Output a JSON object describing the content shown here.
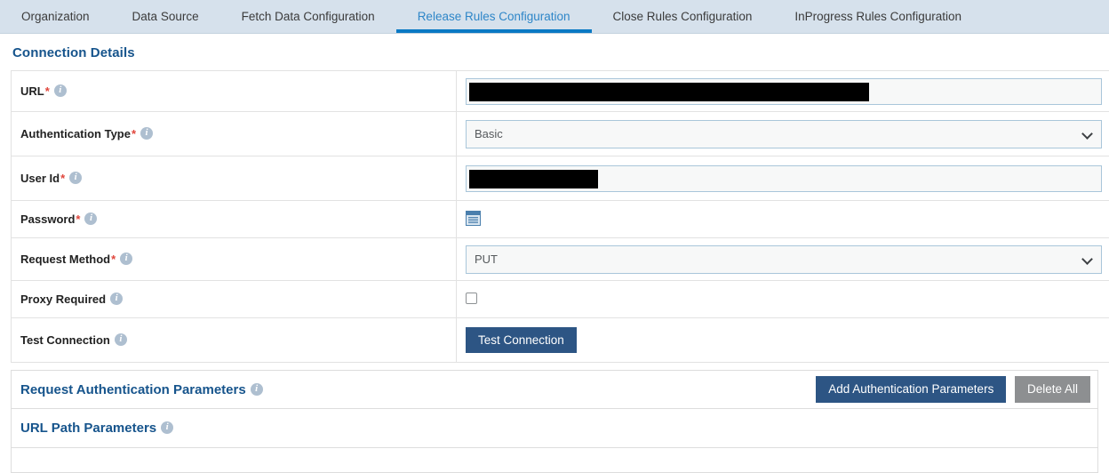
{
  "tabs": [
    {
      "label": "Organization",
      "active": false
    },
    {
      "label": "Data Source",
      "active": false
    },
    {
      "label": "Fetch Data Configuration",
      "active": false
    },
    {
      "label": "Release Rules Configuration",
      "active": true
    },
    {
      "label": "Close Rules Configuration",
      "active": false
    },
    {
      "label": "InProgress Rules Configuration",
      "active": false
    }
  ],
  "connection_details": {
    "title": "Connection Details",
    "rows": {
      "url": {
        "label": "URL",
        "required": true,
        "value": "",
        "redacted": true
      },
      "authentication_type": {
        "label": "Authentication Type",
        "required": true,
        "value": "Basic",
        "options": [
          "Basic"
        ]
      },
      "user_id": {
        "label": "User Id",
        "required": true,
        "value": "",
        "redacted": true
      },
      "password": {
        "label": "Password",
        "required": true,
        "icon": "password-list-icon"
      },
      "request_method": {
        "label": "Request Method",
        "required": true,
        "value": "PUT",
        "options": [
          "PUT"
        ]
      },
      "proxy_required": {
        "label": "Proxy Required",
        "required": false,
        "checked": false
      },
      "test_connection": {
        "label": "Test Connection",
        "required": false,
        "button_label": "Test Connection"
      }
    }
  },
  "request_authentication_parameters": {
    "title": "Request Authentication Parameters",
    "add_button": "Add Authentication Parameters",
    "delete_button": "Delete All"
  },
  "url_path_parameters": {
    "title": "URL Path Parameters"
  },
  "colors": {
    "tabbar_bg": "#d6e1ec",
    "active_tab_text": "#2e86c8",
    "active_tab_underline": "#0a79c4",
    "heading": "#16548c",
    "primary_button": "#2d5584",
    "grey_button": "#8d8f91",
    "required_asterisk": "#e0463c",
    "input_border": "#a9c6da",
    "input_bg": "#f7f8f8"
  },
  "icons": {
    "info": "info-icon",
    "chevron_down": "chevron-down-icon",
    "checkbox": "checkbox-icon"
  }
}
